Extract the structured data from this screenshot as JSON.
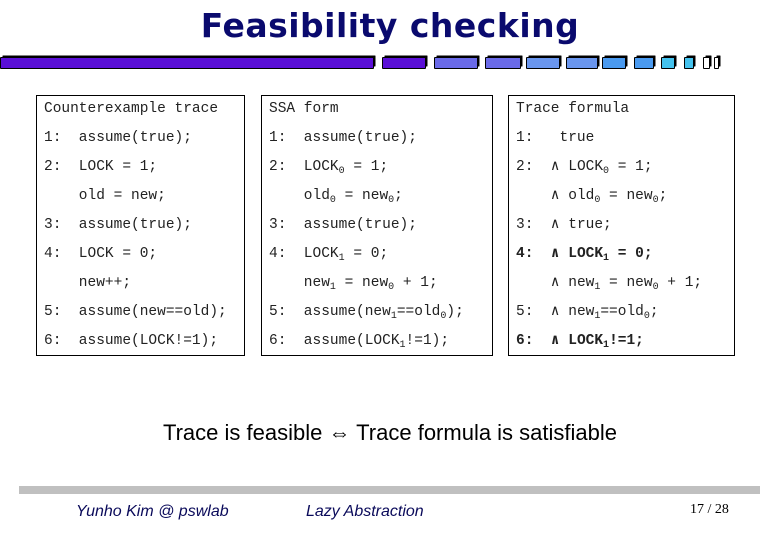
{
  "slide": {
    "title": "Feasibility checking",
    "decoration": {
      "bar_colors": [
        "#5a0fd6",
        "#5a0fd6",
        "#6a6ae8",
        "#6a6ae8",
        "#6a96ee",
        "#6a96ee",
        "#4a9af0",
        "#4a9af0",
        "#44c2ee",
        "#44c2ee",
        "#ffffff",
        "#ffffff"
      ]
    },
    "columns": [
      {
        "header": "Counterexample trace",
        "lines": [
          {
            "n": "1:",
            "text": "assume(true);"
          },
          {
            "n": "2:",
            "text": "LOCK = 1;"
          },
          {
            "n": "",
            "text": "old = new;"
          },
          {
            "n": "3:",
            "text": "assume(true);"
          },
          {
            "n": "4:",
            "text": "LOCK = 0;"
          },
          {
            "n": "",
            "text": "new++;"
          },
          {
            "n": "5:",
            "text": "assume(new==old);"
          },
          {
            "n": "6:",
            "text": "assume(LOCK!=1);"
          }
        ]
      },
      {
        "header": "SSA form",
        "lines": [
          {
            "n": "1:",
            "text": "assume(true);"
          },
          {
            "n": "2:",
            "text": "LOCK_0 = 1;"
          },
          {
            "n": "",
            "text": "old_0 = new_0;"
          },
          {
            "n": "3:",
            "text": "assume(true);"
          },
          {
            "n": "4:",
            "text": "LOCK_1 = 0;"
          },
          {
            "n": "",
            "text": "new_1 = new_0 + 1;"
          },
          {
            "n": "5:",
            "text": "assume(new_1==old_0);"
          },
          {
            "n": "6:",
            "text": "assume(LOCK_1!=1);"
          }
        ]
      },
      {
        "header": "Trace formula",
        "lines": [
          {
            "n": "1:",
            "text": " true",
            "bold": false
          },
          {
            "n": "2:",
            "text": "∧ LOCK_0 = 1;",
            "bold": false
          },
          {
            "n": "",
            "text": "∧ old_0 = new_0;",
            "bold": false
          },
          {
            "n": "3:",
            "text": "∧ true;",
            "bold": false
          },
          {
            "n": "4:",
            "text": "∧ LOCK_1 = 0;",
            "bold": true
          },
          {
            "n": "",
            "text": "∧ new_1 = new_0 + 1;",
            "bold": false
          },
          {
            "n": "5:",
            "text": "∧ new_1==old_0;",
            "bold": false
          },
          {
            "n": "6:",
            "text": "∧ LOCK_1!=1;",
            "bold": true
          }
        ]
      }
    ],
    "statement": "Trace is feasible ⇔ Trace formula is satisfiable",
    "footer": {
      "author": "Yunho Kim @ pswlab",
      "topic": "Lazy Abstraction",
      "page": "17 / 28"
    }
  }
}
